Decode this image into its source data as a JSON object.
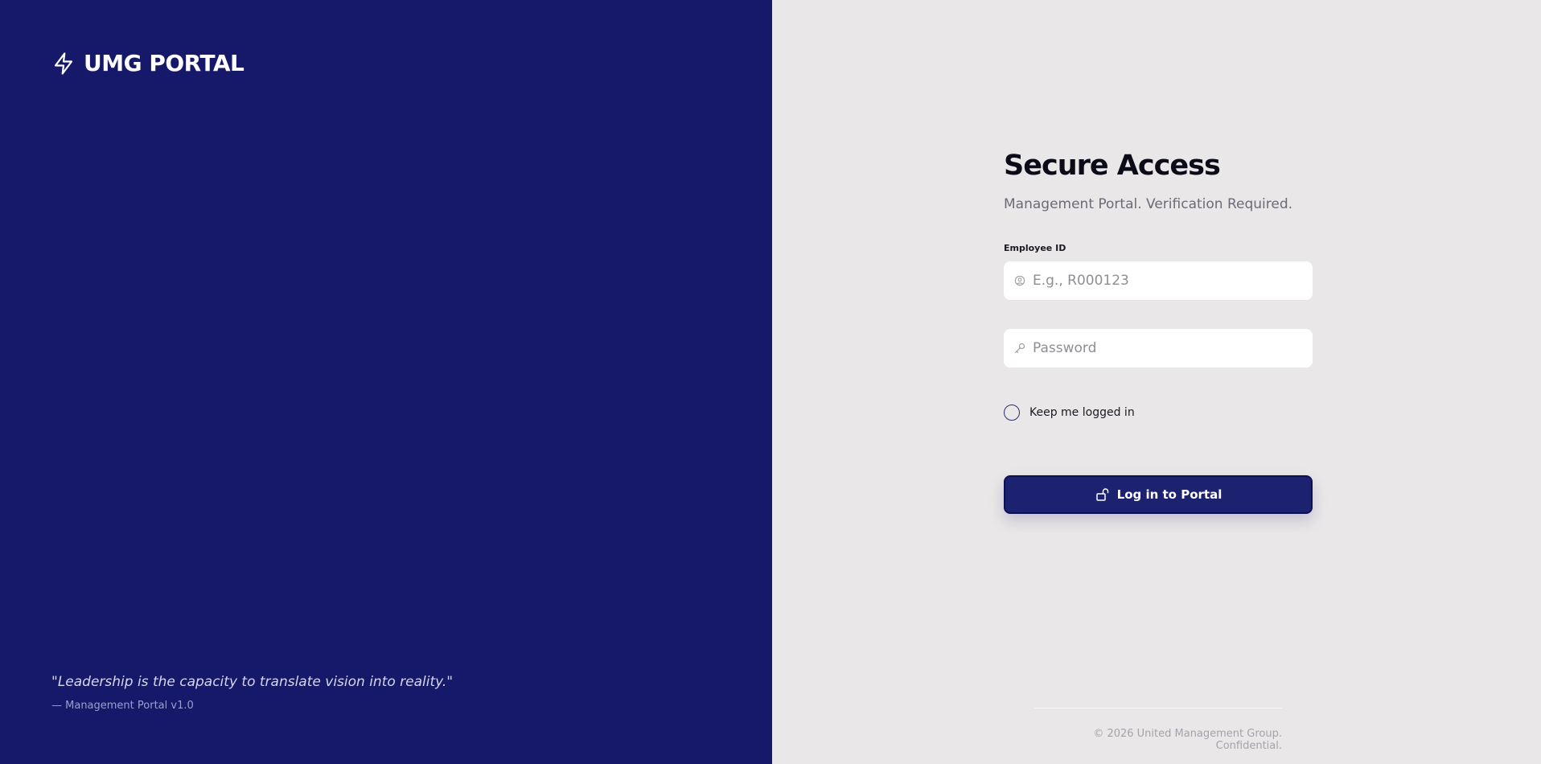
{
  "brand": {
    "logo_icon": "bolt-icon",
    "name": "UMG PORTAL",
    "quote": "\"Leadership is the capacity to translate vision into reality.\"",
    "attribution": "— Management Portal v1.0"
  },
  "form": {
    "title": "Secure Access",
    "subtitle": "Management Portal. Verification Required.",
    "employee_id": {
      "label": "Employee ID",
      "placeholder": "E.g., R000123",
      "value": "",
      "icon": "user-circle-icon"
    },
    "password": {
      "placeholder": "Password",
      "value": "",
      "icon": "key-icon"
    },
    "remember_me": {
      "label": "Keep me logged in",
      "checked": false
    },
    "submit": {
      "label": "Log in to Portal",
      "icon": "unlock-icon"
    }
  },
  "footer": {
    "text": "© 2026 United Management Group. Confidential."
  },
  "colors": {
    "brand_bg": "#16186a",
    "form_bg": "#e9e7e7",
    "button_bg": "#1c226f",
    "title": "#0c0c18"
  }
}
